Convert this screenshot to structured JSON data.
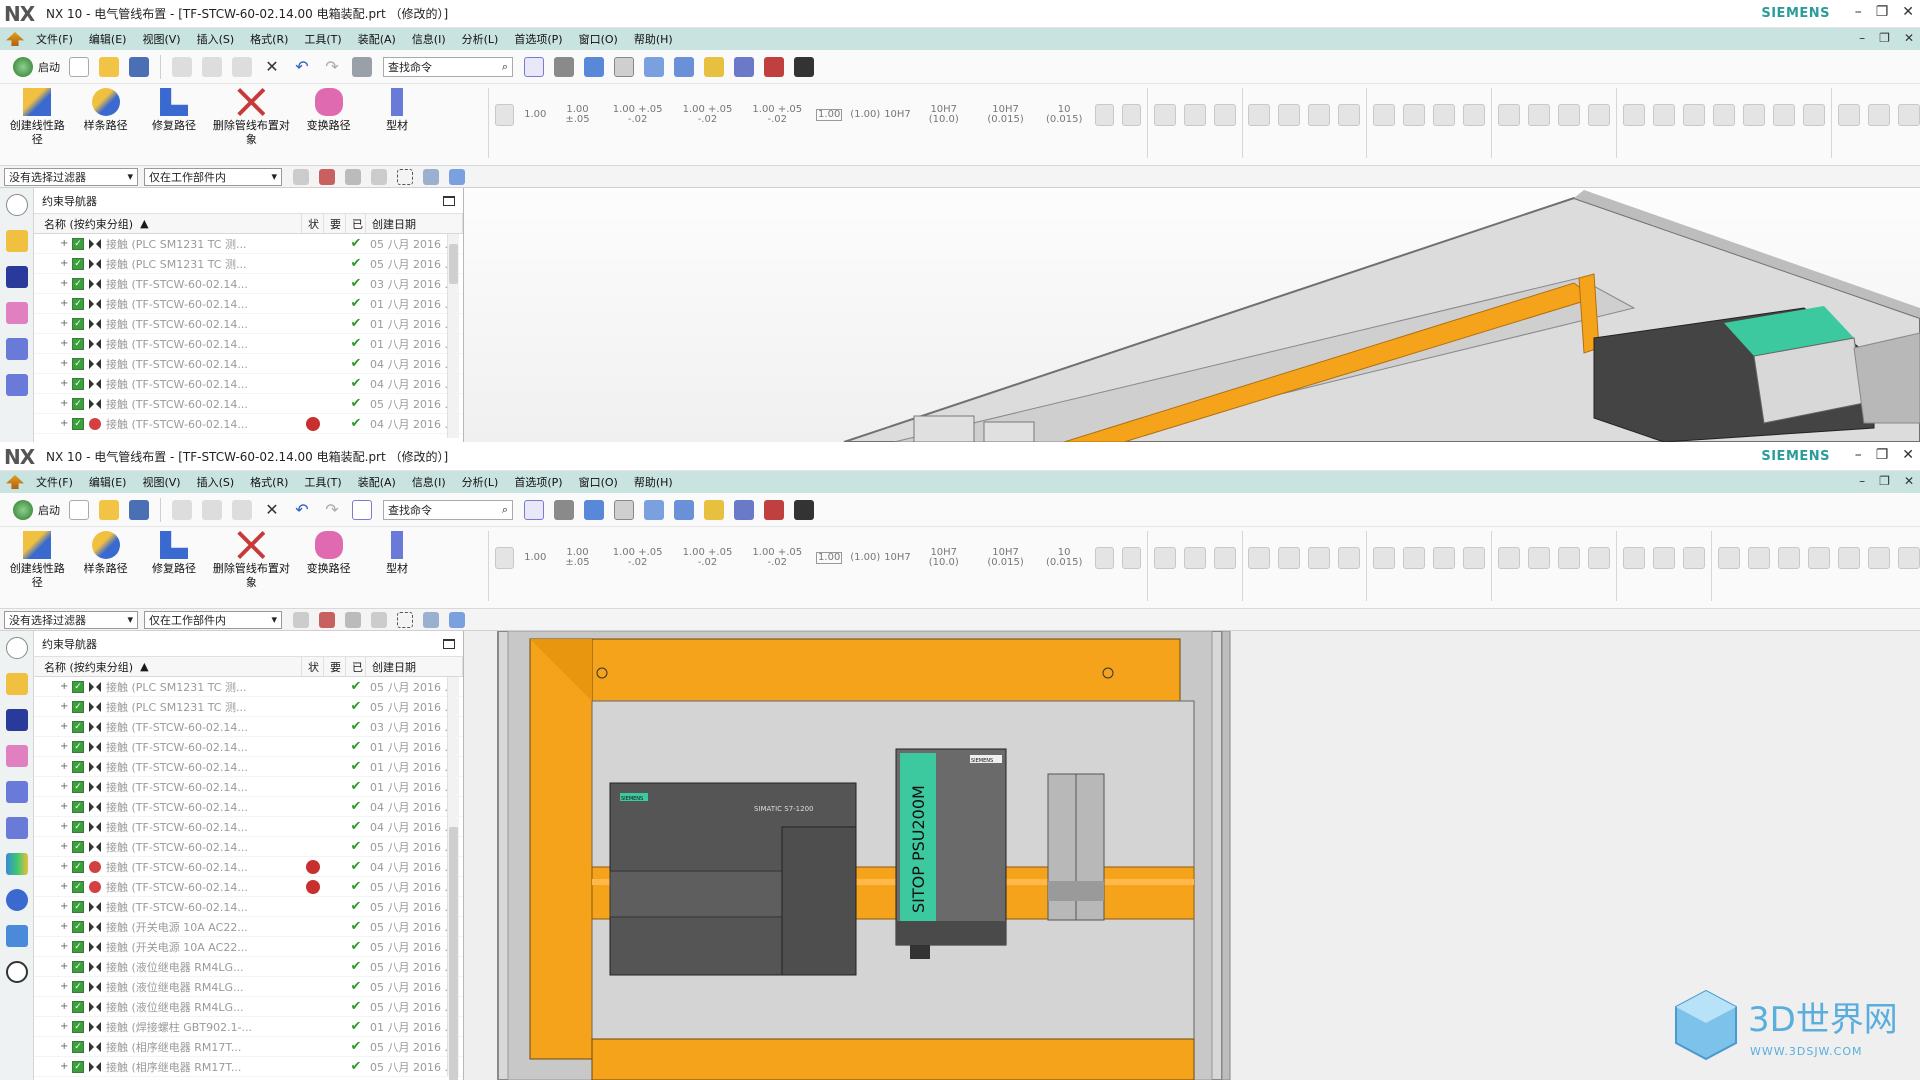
{
  "app": {
    "logo": "NX",
    "title": "NX 10 - 电气管线布置 - [TF-STCW-60-02.14.00 电箱装配.prt （修改的）]",
    "brand": "SIEMENS"
  },
  "menu": [
    "文件(F)",
    "编辑(E)",
    "视图(V)",
    "插入(S)",
    "格式(R)",
    "工具(T)",
    "装配(A)",
    "信息(I)",
    "分析(L)",
    "首选项(P)",
    "窗口(O)",
    "帮助(H)"
  ],
  "toolbar": {
    "start_label": "启动",
    "command_search": "查找命令"
  },
  "ribbon": {
    "buttons": [
      "创建线性路径",
      "样条路径",
      "修复路径",
      "删除管线布置对象",
      "变换路径",
      "型材"
    ],
    "tolerances": [
      "1.00",
      "1.00 ±.05",
      "1.00 +.05 -.02",
      "1.00 +.05 -.02",
      "1.00 +.05 -.02",
      "1.00",
      "(1.00)",
      "10H7",
      "10H7 (10.0)",
      "10H7 (0.015)",
      "10 (0.015)"
    ]
  },
  "filterbar": {
    "selection_filter": "没有选择过滤器",
    "scope": "仅在工作部件内"
  },
  "navigator": {
    "title": "约束导航器",
    "columns": [
      "名称 (按约束分组)",
      "状",
      "要",
      "已",
      "创建日期"
    ]
  },
  "rows_top": [
    {
      "name": "接触 (PLC SM1231 TC  测...",
      "date": "05 八月 2016 ...",
      "err": false
    },
    {
      "name": "接触 (PLC SM1231 TC  测...",
      "date": "05 八月 2016 ...",
      "err": false
    },
    {
      "name": "接触 (TF-STCW-60-02.14...",
      "date": "03 八月 2016 ...",
      "err": false
    },
    {
      "name": "接触 (TF-STCW-60-02.14...",
      "date": "01 八月 2016 ...",
      "err": false
    },
    {
      "name": "接触 (TF-STCW-60-02.14...",
      "date": "01 八月 2016 ...",
      "err": false
    },
    {
      "name": "接触 (TF-STCW-60-02.14...",
      "date": "01 八月 2016 ...",
      "err": false
    },
    {
      "name": "接触 (TF-STCW-60-02.14...",
      "date": "04 八月 2016 ...",
      "err": false
    },
    {
      "name": "接触 (TF-STCW-60-02.14...",
      "date": "04 八月 2016 ...",
      "err": false
    },
    {
      "name": "接触 (TF-STCW-60-02.14...",
      "date": "05 八月 2016 ...",
      "err": false
    },
    {
      "name": "接触 (TF-STCW-60-02.14...",
      "date": "04 八月 2016 ...",
      "err": true
    }
  ],
  "rows_bottom": [
    {
      "name": "接触 (PLC SM1231 TC  测...",
      "date": "05 八月 2016 ...",
      "err": false
    },
    {
      "name": "接触 (PLC SM1231 TC  测...",
      "date": "05 八月 2016 ...",
      "err": false
    },
    {
      "name": "接触 (TF-STCW-60-02.14...",
      "date": "03 八月 2016 ...",
      "err": false
    },
    {
      "name": "接触 (TF-STCW-60-02.14...",
      "date": "01 八月 2016 ...",
      "err": false
    },
    {
      "name": "接触 (TF-STCW-60-02.14...",
      "date": "01 八月 2016 ...",
      "err": false
    },
    {
      "name": "接触 (TF-STCW-60-02.14...",
      "date": "01 八月 2016 ...",
      "err": false
    },
    {
      "name": "接触 (TF-STCW-60-02.14...",
      "date": "04 八月 2016 ...",
      "err": false
    },
    {
      "name": "接触 (TF-STCW-60-02.14...",
      "date": "04 八月 2016 ...",
      "err": false
    },
    {
      "name": "接触 (TF-STCW-60-02.14...",
      "date": "05 八月 2016 ...",
      "err": false
    },
    {
      "name": "接触 (TF-STCW-60-02.14...",
      "date": "04 八月 2016 ...",
      "err": true
    },
    {
      "name": "接触 (TF-STCW-60-02.14...",
      "date": "05 八月 2016 ...",
      "err": true
    },
    {
      "name": "接触 (TF-STCW-60-02.14...",
      "date": "05 八月 2016 ...",
      "err": false
    },
    {
      "name": "接触 (开关电源 10A AC22...",
      "date": "05 八月 2016 ...",
      "err": false
    },
    {
      "name": "接触 (开关电源 10A AC22...",
      "date": "05 八月 2016 ...",
      "err": false
    },
    {
      "name": "接触 (液位继电器 RM4LG...",
      "date": "05 八月 2016 ...",
      "err": false
    },
    {
      "name": "接触 (液位继电器 RM4LG...",
      "date": "05 八月 2016 ...",
      "err": false
    },
    {
      "name": "接触 (液位继电器 RM4LG...",
      "date": "05 八月 2016 ...",
      "err": false
    },
    {
      "name": "接触 (焊接螺柱 GBT902.1-...",
      "date": "01 八月 2016 ...",
      "err": false
    },
    {
      "name": "接触 (相序继电器 RM17T...",
      "date": "05 八月 2016 ...",
      "err": false
    },
    {
      "name": "接触 (相序继电器 RM17T...",
      "date": "05 八月 2016 ...",
      "err": false
    }
  ],
  "model": {
    "plc_brand": "SIEMENS",
    "plc_name": "SIMATIC S7-1200",
    "psu_name": "SITOP PSU200M",
    "psu_brand": "SIEMENS"
  },
  "watermark": {
    "logo": "3D世界网",
    "url": "WWW.3DSJW.COM"
  },
  "colors": {
    "menubar": "#c9e3e0",
    "din_rail": "#f5a31a",
    "psu_green": "#3dc9a0",
    "brand_teal": "#2a9c9c"
  }
}
